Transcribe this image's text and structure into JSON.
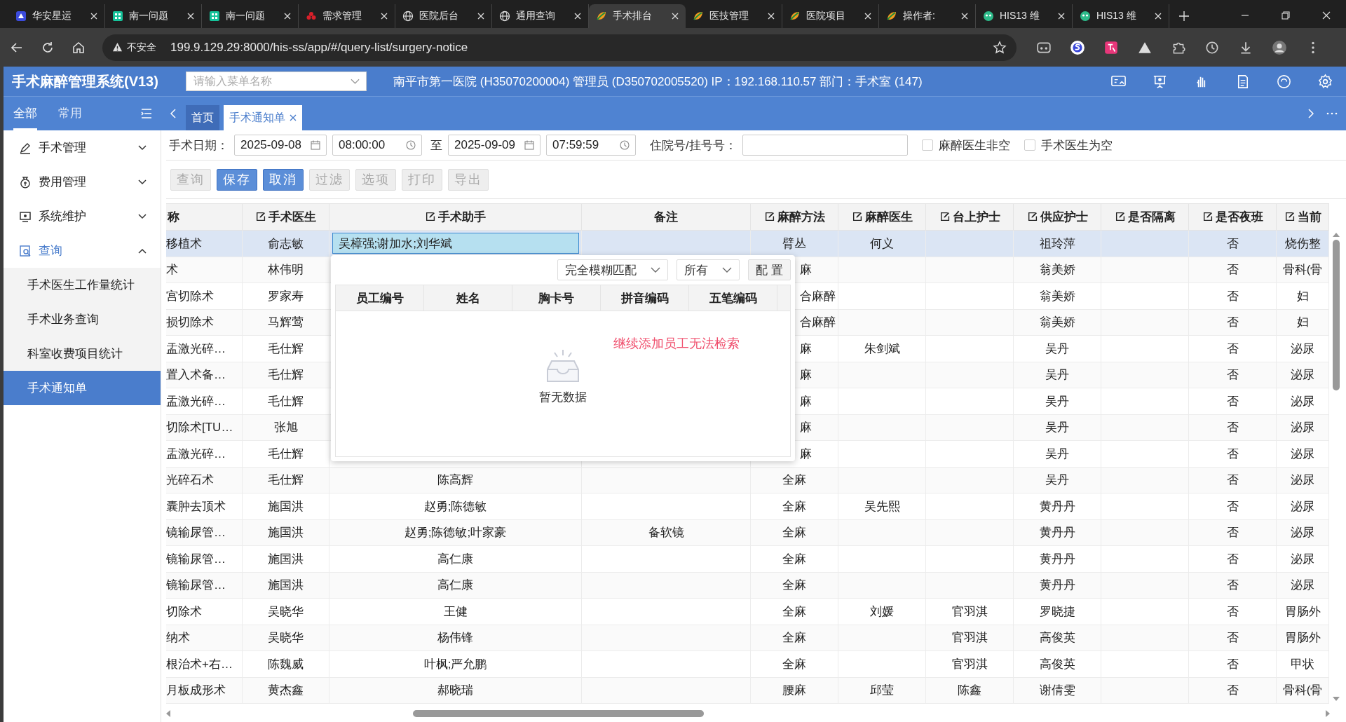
{
  "browser": {
    "tabs": [
      {
        "title": "华安星运",
        "kind": "app",
        "selected": false
      },
      {
        "title": "南一问题",
        "kind": "grid",
        "selected": false
      },
      {
        "title": "南一问题",
        "kind": "grid",
        "selected": false
      },
      {
        "title": "需求管理",
        "kind": "flower",
        "selected": false
      },
      {
        "title": "医院后台",
        "kind": "globe",
        "selected": false
      },
      {
        "title": "通用查询",
        "kind": "globe",
        "selected": false
      },
      {
        "title": "手术排台",
        "kind": "leaf",
        "selected": true
      },
      {
        "title": "医技管理",
        "kind": "leaf",
        "selected": false
      },
      {
        "title": "医院项目",
        "kind": "leaf",
        "selected": false
      },
      {
        "title": "操作者:",
        "kind": "leaf",
        "selected": false
      },
      {
        "title": "HIS13 维",
        "kind": "bot",
        "selected": false
      },
      {
        "title": "HIS13 维",
        "kind": "bot",
        "selected": false
      }
    ],
    "address": {
      "security": "不安全",
      "url": "199.9.129.29:8000/his-ss/app/#/query-list/surgery-notice"
    }
  },
  "app": {
    "title": "手术麻醉管理系统(V13)",
    "menu_search": {
      "placeholder": "请输入菜单名称"
    },
    "info": "南平市第一医院 (H35070200004) 管理员 (D350702005520) IP：192.168.110.57 部门：手术室 (147)"
  },
  "sidebar": {
    "tabs": [
      {
        "label": "全部",
        "selected": true
      },
      {
        "label": "常用",
        "selected": false
      }
    ],
    "items": [
      {
        "label": "手术管理",
        "kind": "pen",
        "expanded": false
      },
      {
        "label": "费用管理",
        "kind": "money",
        "expanded": false
      },
      {
        "label": "系统维护",
        "kind": "monitor",
        "expanded": false
      },
      {
        "label": "查询",
        "kind": "search",
        "expanded": true,
        "children": [
          {
            "label": "手术医生工作量统计",
            "selected": false
          },
          {
            "label": "手术业务查询",
            "selected": false
          },
          {
            "label": "科室收费项目统计",
            "selected": false
          },
          {
            "label": "手术通知单",
            "selected": true
          }
        ]
      }
    ]
  },
  "page_tabs": [
    {
      "label": "首页",
      "closable": false,
      "selected": false
    },
    {
      "label": "手术通知单",
      "closable": true,
      "selected": true
    }
  ],
  "filters": {
    "date_label": "手术日期：",
    "start_date": "2025-09-08",
    "start_time": "08:00:00",
    "to_label": "至",
    "end_date": "2025-09-09",
    "end_time": "07:59:59",
    "record_label": "住院号/挂号号：",
    "checkboxes": [
      {
        "label": "麻醉医生非空",
        "checked": false
      },
      {
        "label": "手术医生为空",
        "checked": false
      }
    ]
  },
  "buttons": [
    {
      "label": "查询",
      "disabled": true
    },
    {
      "label": "保存",
      "disabled": false
    },
    {
      "label": "取消",
      "disabled": false
    },
    {
      "label": "过滤",
      "disabled": true
    },
    {
      "label": "选项",
      "disabled": true
    },
    {
      "label": "打印",
      "disabled": true
    },
    {
      "label": "导出",
      "disabled": true
    }
  ],
  "table": {
    "columns": [
      {
        "label": "称",
        "editable": false
      },
      {
        "label": "手术医生",
        "editable": true
      },
      {
        "label": "手术助手",
        "editable": true
      },
      {
        "label": "备注",
        "editable": false
      },
      {
        "label": "麻醉方法",
        "editable": true
      },
      {
        "label": "麻醉医生",
        "editable": true
      },
      {
        "label": "台上护士",
        "editable": true
      },
      {
        "label": "供应护士",
        "editable": true
      },
      {
        "label": "是否隔离",
        "editable": true
      },
      {
        "label": "是否夜班",
        "editable": true
      },
      {
        "label": "当前",
        "editable": true
      }
    ],
    "rows": [
      {
        "selected": true,
        "cells": [
          "移植术",
          "俞志敏",
          {
            "value": "吴樟强;谢加水;刘华斌",
            "editing": true
          },
          null,
          "臂丛",
          "何义",
          null,
          "祖玲萍",
          null,
          "否",
          "烧伤整"
        ]
      },
      {
        "selected": false,
        "cells": [
          "术",
          "林伟明",
          null,
          null,
          {
            "text": "麻",
            "partial": true
          },
          null,
          null,
          "翁美娇",
          null,
          "否",
          "骨科(骨"
        ]
      },
      {
        "selected": false,
        "cells": [
          "宫切除术",
          "罗家寿",
          null,
          null,
          {
            "text": "合麻醉",
            "partial": true
          },
          null,
          null,
          "翁美娇",
          null,
          "否",
          "妇"
        ]
      },
      {
        "selected": false,
        "cells": [
          "损切除术",
          "马辉莺",
          null,
          null,
          {
            "text": "合麻醉",
            "partial": true
          },
          null,
          null,
          "翁美娇",
          null,
          "否",
          "妇"
        ]
      },
      {
        "selected": false,
        "cells": [
          "盂激光碎…",
          "毛仕辉",
          null,
          null,
          {
            "text": "麻",
            "partial": true
          },
          "朱剑斌",
          null,
          "吴丹",
          null,
          "否",
          "泌尿"
        ]
      },
      {
        "selected": false,
        "cells": [
          "置入术备…",
          "毛仕辉",
          null,
          null,
          {
            "text": "麻",
            "partial": true
          },
          null,
          null,
          "吴丹",
          null,
          "否",
          "泌尿"
        ]
      },
      {
        "selected": false,
        "cells": [
          "盂激光碎…",
          "毛仕辉",
          null,
          null,
          {
            "text": "麻",
            "partial": true
          },
          null,
          null,
          "吴丹",
          null,
          "否",
          "泌尿"
        ]
      },
      {
        "selected": false,
        "cells": [
          "切除术[TU…",
          "张旭",
          null,
          null,
          {
            "text": "麻",
            "partial": true
          },
          null,
          null,
          "吴丹",
          null,
          "否",
          "泌尿"
        ]
      },
      {
        "selected": false,
        "cells": [
          "盂激光碎…",
          "毛仕辉",
          null,
          null,
          {
            "text": "麻",
            "partial": true
          },
          null,
          null,
          "吴丹",
          null,
          "否",
          "泌尿"
        ]
      },
      {
        "selected": false,
        "cells": [
          "光碎石术",
          "毛仕辉",
          "陈高辉",
          null,
          "全麻",
          null,
          null,
          "吴丹",
          null,
          "否",
          "泌尿"
        ]
      },
      {
        "selected": false,
        "cells": [
          "囊肿去顶术",
          "施国洪",
          "赵勇;陈德敏",
          null,
          "全麻",
          "吴先熙",
          null,
          "黄丹丹",
          null,
          "否",
          "泌尿"
        ]
      },
      {
        "selected": false,
        "cells": [
          "镜输尿管…",
          "施国洪",
          "赵勇;陈德敏;叶家豪",
          "备软镜",
          "全麻",
          null,
          null,
          "黄丹丹",
          null,
          "否",
          "泌尿"
        ]
      },
      {
        "selected": false,
        "cells": [
          "镜输尿管…",
          "施国洪",
          "高仁康",
          null,
          "全麻",
          null,
          null,
          "黄丹丹",
          null,
          "否",
          "泌尿"
        ]
      },
      {
        "selected": false,
        "cells": [
          "镜输尿管…",
          "施国洪",
          "高仁康",
          null,
          "全麻",
          null,
          null,
          "黄丹丹",
          null,
          "否",
          "泌尿"
        ]
      },
      {
        "selected": false,
        "cells": [
          "切除术",
          "吴晓华",
          "王健",
          null,
          "全麻",
          "刘媛",
          "官羽淇",
          "罗晓捷",
          null,
          "否",
          "胃肠外"
        ]
      },
      {
        "selected": false,
        "cells": [
          "纳术",
          "吴晓华",
          "杨伟锋",
          null,
          "全麻",
          null,
          "官羽淇",
          "高俊英",
          null,
          "否",
          "胃肠外"
        ]
      },
      {
        "selected": false,
        "cells": [
          "根治术+右…",
          "陈魏威",
          "叶枫;严允鹏",
          null,
          "全麻",
          null,
          "官羽淇",
          "高俊英",
          null,
          "否",
          "甲状"
        ]
      },
      {
        "selected": false,
        "cells": [
          "月板成形术",
          "黄杰鑫",
          "郝晓瑞",
          null,
          "腰麻",
          "邱莹",
          "陈鑫",
          "谢倩雯",
          null,
          "否",
          "骨科(骨"
        ]
      }
    ]
  },
  "picker": {
    "match_mode": "完全模糊匹配",
    "scope": "所有",
    "config_button": "配 置",
    "columns": [
      "员工编号",
      "姓名",
      "胸卡号",
      "拼音编码",
      "五笔编码"
    ],
    "empty_text": "暂无数据",
    "note": "继续添加员工无法检索"
  }
}
